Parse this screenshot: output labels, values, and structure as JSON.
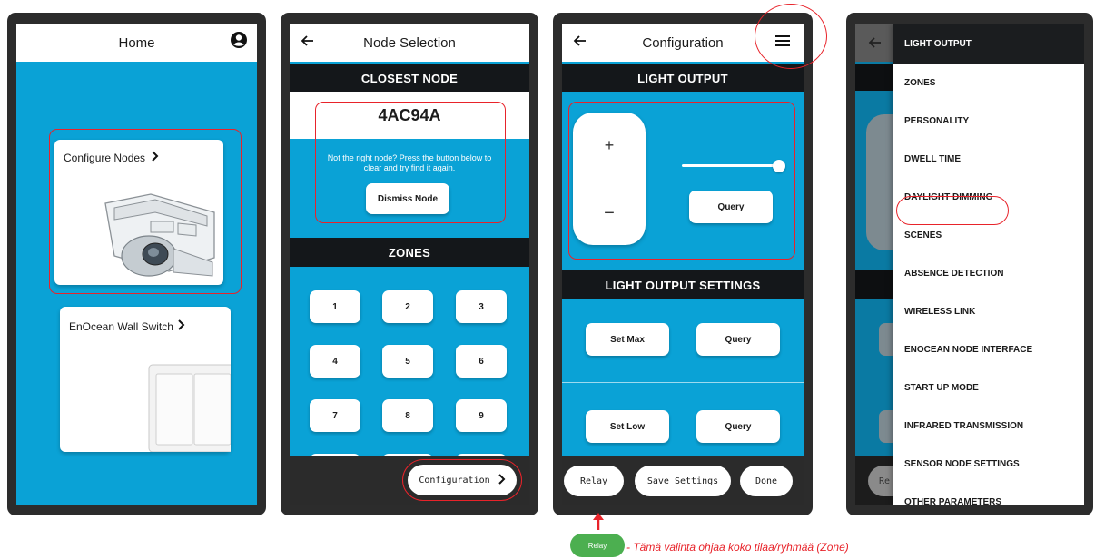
{
  "screen1": {
    "title": "Home",
    "cards": [
      {
        "label": "Configure Nodes",
        "chevron": "›"
      },
      {
        "label": "EnOcean Wall Switch",
        "chevron": "›"
      }
    ]
  },
  "screen2": {
    "title": "Node Selection",
    "closest_header": "CLOSEST NODE",
    "node_id": "4AC94A",
    "info_text": "Not the right node? Press the button below to clear and try find it again.",
    "dismiss_label": "Dismiss Node",
    "zones_header": "ZONES",
    "zones": [
      "1",
      "2",
      "3",
      "4",
      "5",
      "6",
      "7",
      "8",
      "9"
    ],
    "config_label": "Configuration"
  },
  "screen3": {
    "title": "Configuration",
    "light_output_header": "LIGHT OUTPUT",
    "plus": "+",
    "minus": "−",
    "slider_level": 1.0,
    "query_label": "Query",
    "settings_header": "LIGHT OUTPUT SETTINGS",
    "set_max_label": "Set Max",
    "set_low_label": "Set Low",
    "query_label_2": "Query",
    "query_label_3": "Query",
    "relay_label": "Relay",
    "save_label": "Save Settings",
    "done_label": "Done"
  },
  "screen4": {
    "partial_bottom": "Re",
    "menu": [
      "LIGHT OUTPUT",
      "ZONES",
      "PERSONALITY",
      "DWELL TIME",
      "DAYLIGHT DIMMING",
      "SCENES",
      "ABSENCE DETECTION",
      "WIRELESS LINK",
      "ENOCEAN NODE INTERFACE",
      "START UP MODE",
      "INFRARED TRANSMISSION",
      "SENSOR NODE SETTINGS",
      "OTHER PARAMETERS"
    ]
  },
  "annotation": {
    "relay_badge": "Relay",
    "note": "- Tämä valinta ohjaa koko tilaa/ryhmää (Zone)"
  },
  "colors": {
    "accent": "#0aa2d6",
    "dark": "#14171a",
    "highlight": "#e8232a",
    "relay_green": "#4caf50"
  }
}
